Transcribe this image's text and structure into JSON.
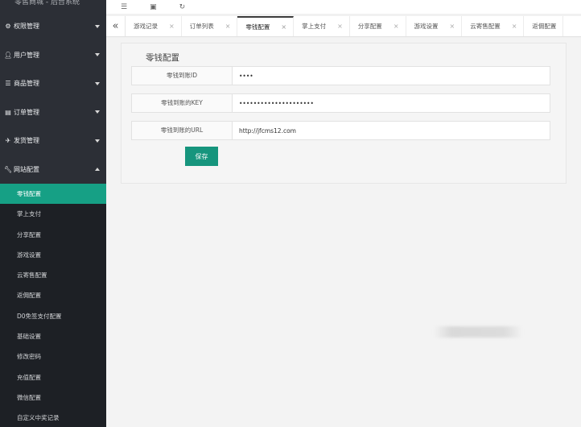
{
  "app": {
    "title": "零售商城 - 后台系统"
  },
  "topbar": {
    "icons": [
      "menu-icon",
      "monitor-icon",
      "refresh-icon"
    ]
  },
  "sidebar": {
    "groups": [
      {
        "label": "权限管理",
        "icon": "gear-icon"
      },
      {
        "label": "用户管理",
        "icon": "user-icon"
      },
      {
        "label": "商品管理",
        "icon": "list-icon"
      },
      {
        "label": "订单管理",
        "icon": "order-icon"
      },
      {
        "label": "发货管理",
        "icon": "truck-icon"
      },
      {
        "label": "网站配置",
        "icon": "wrench-icon"
      }
    ],
    "sub_items": [
      {
        "label": "零钱配置"
      },
      {
        "label": "掌上支付"
      },
      {
        "label": "分享配置"
      },
      {
        "label": "游戏设置"
      },
      {
        "label": "云寄售配置"
      },
      {
        "label": "返佣配置"
      },
      {
        "label": "D0免签支付配置"
      },
      {
        "label": "基础设置"
      },
      {
        "label": "修改密码"
      },
      {
        "label": "充值配置"
      },
      {
        "label": "微信配置"
      },
      {
        "label": "自定义中奖记录"
      }
    ]
  },
  "tabs": [
    {
      "label": "游戏记录"
    },
    {
      "label": "订单列表"
    },
    {
      "label": "零钱配置"
    },
    {
      "label": "掌上支付"
    },
    {
      "label": "分享配置"
    },
    {
      "label": "游戏设置"
    },
    {
      "label": "云寄售配置"
    },
    {
      "label": "返佣配置"
    }
  ],
  "form": {
    "title": "零钱配置",
    "fields": [
      {
        "label": "零钱到账ID",
        "value": "••••"
      },
      {
        "label": "零钱到账的KEY",
        "value": "•••••••••••••••••••••"
      },
      {
        "label": "零钱到账的URL",
        "value": "http://jfcms12.com"
      }
    ],
    "save_label": "保存"
  },
  "colors": {
    "sidebar_bg": "#2c2f36",
    "accent": "#16a085",
    "button": "#16957d"
  }
}
